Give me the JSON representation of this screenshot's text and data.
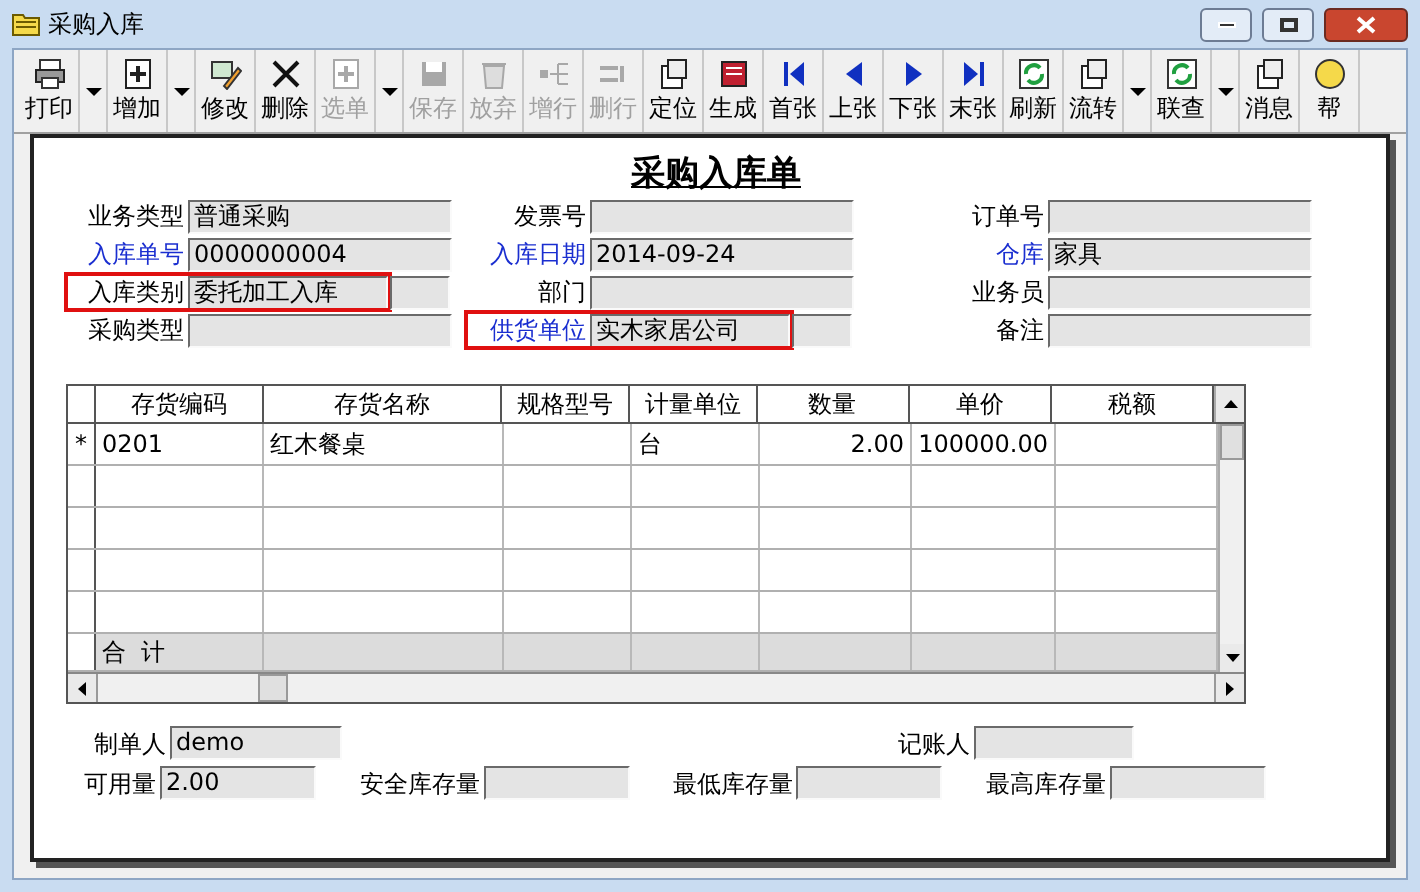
{
  "window": {
    "title": "采购入库"
  },
  "toolbar": [
    {
      "label": "打印",
      "kind": "printer",
      "disabled": false,
      "dropdown": true
    },
    {
      "label": "增加",
      "kind": "add",
      "disabled": false,
      "dropdown": true
    },
    {
      "label": "修改",
      "kind": "edit",
      "disabled": false,
      "dropdown": false
    },
    {
      "label": "删除",
      "kind": "delete",
      "disabled": false,
      "dropdown": false
    },
    {
      "label": "选单",
      "kind": "add",
      "disabled": true,
      "dropdown": true
    },
    {
      "label": "保存",
      "kind": "save",
      "disabled": true,
      "dropdown": false
    },
    {
      "label": "放弃",
      "kind": "trash",
      "disabled": true,
      "dropdown": false
    },
    {
      "label": "增行",
      "kind": "addrow",
      "disabled": true,
      "dropdown": false
    },
    {
      "label": "删行",
      "kind": "delrow",
      "disabled": true,
      "dropdown": false
    },
    {
      "label": "定位",
      "kind": "doc",
      "disabled": false,
      "dropdown": false
    },
    {
      "label": "生成",
      "kind": "book",
      "disabled": false,
      "dropdown": false
    },
    {
      "label": "首张",
      "kind": "first",
      "disabled": false,
      "dropdown": false
    },
    {
      "label": "上张",
      "kind": "prev",
      "disabled": false,
      "dropdown": false
    },
    {
      "label": "下张",
      "kind": "next",
      "disabled": false,
      "dropdown": false
    },
    {
      "label": "末张",
      "kind": "last",
      "disabled": false,
      "dropdown": false
    },
    {
      "label": "刷新",
      "kind": "refresh",
      "disabled": false,
      "dropdown": false
    },
    {
      "label": "流转",
      "kind": "doc",
      "disabled": false,
      "dropdown": true
    },
    {
      "label": "联查",
      "kind": "refresh",
      "disabled": false,
      "dropdown": true
    },
    {
      "label": "消息",
      "kind": "doc",
      "disabled": false,
      "dropdown": false
    },
    {
      "label": "帮",
      "kind": "help",
      "disabled": false,
      "dropdown": false
    }
  ],
  "form": {
    "title": "采购入库单",
    "fields": [
      {
        "label": "业务类型",
        "value": "普通采购",
        "link": false,
        "highlighted": false
      },
      {
        "label": "发票号",
        "link": false,
        "highlighted": false
      },
      {
        "label": "订单号",
        "link": false,
        "highlighted": false
      },
      {
        "label": "入库单号",
        "value": "0000000004",
        "link": true,
        "highlighted": false
      },
      {
        "label": "入库日期",
        "value": "2014-09-24",
        "link": true,
        "highlighted": false
      },
      {
        "label": "仓库",
        "value": "家具",
        "link": true,
        "highlighted": false
      },
      {
        "label": "入库类别",
        "value": "委托加工入库",
        "link": false,
        "highlighted": true
      },
      {
        "label": "部门",
        "link": false,
        "highlighted": false
      },
      {
        "label": "业务员",
        "link": false,
        "highlighted": false
      },
      {
        "label": "采购类型",
        "link": false,
        "highlighted": false
      },
      {
        "label": "供货单位",
        "value": "实木家居公司",
        "link": true,
        "highlighted": true
      },
      {
        "label": "备注",
        "link": false,
        "highlighted": false
      }
    ]
  },
  "table": {
    "columns": [
      {
        "label": "存货编码",
        "numeric": false
      },
      {
        "label": "存货名称",
        "numeric": false
      },
      {
        "label": "规格型号"
      },
      {
        "label": "计量单位",
        "numeric": false
      },
      {
        "label": "数量",
        "numeric": true
      },
      {
        "label": "单价",
        "numeric": true
      },
      {
        "label": "税额"
      }
    ],
    "rows": [
      {
        "marker": "*",
        "cells": [
          "0201",
          "红木餐桌",
          "",
          "台",
          "2.00",
          "100000.00",
          ""
        ]
      }
    ],
    "total_label": "合  计"
  },
  "footer": [
    {
      "label": "制单人",
      "value": "demo"
    },
    {
      "label": "记账人"
    },
    {
      "label": "可用量",
      "value": "2.00"
    },
    {
      "label": "安全库存量"
    },
    {
      "label": "最低库存量"
    },
    {
      "label": "最高库存量"
    }
  ]
}
